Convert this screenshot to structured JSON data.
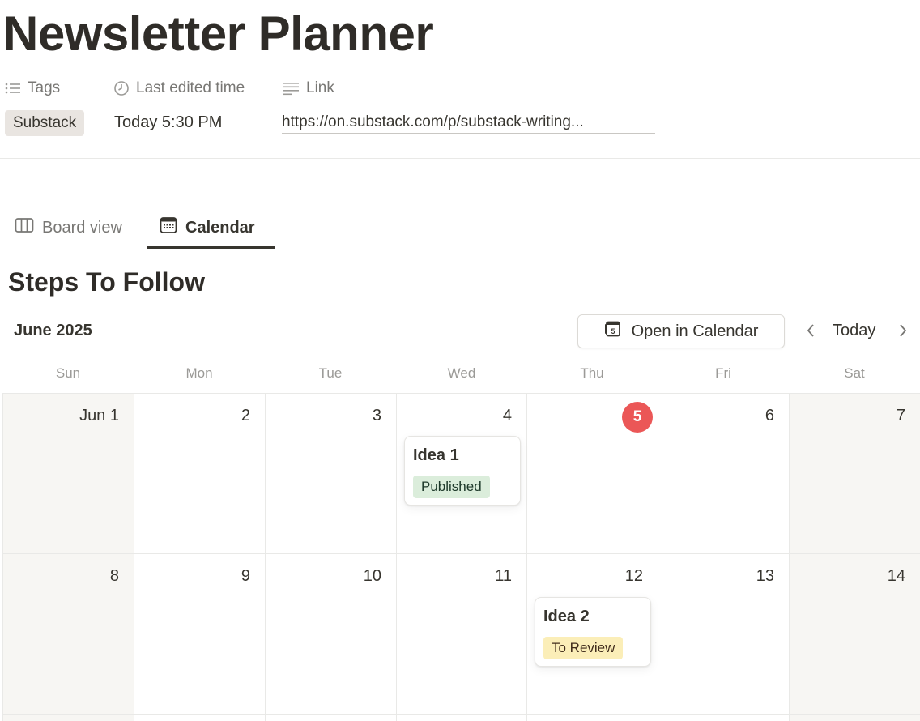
{
  "page": {
    "title": "Newsletter Planner"
  },
  "properties": {
    "tags_label": "Tags",
    "edited_label": "Last edited time",
    "link_label": "Link",
    "tag_value": "Substack",
    "edited_value": "Today 5:30 PM",
    "link_value": "https://on.substack.com/p/substack-writing..."
  },
  "tabs": [
    {
      "label": "Board view",
      "icon": "board-icon",
      "active": false
    },
    {
      "label": "Calendar",
      "icon": "calendar-icon",
      "active": true
    }
  ],
  "section": {
    "title": "Steps To Follow"
  },
  "calendar": {
    "month": "June 2025",
    "open_button": "Open in Calendar",
    "today_button": "Today",
    "weekdays": [
      "Sun",
      "Mon",
      "Tue",
      "Wed",
      "Thu",
      "Fri",
      "Sat"
    ],
    "days": [
      "Jun 1",
      "2",
      "3",
      "4",
      "5",
      "6",
      "7",
      "8",
      "9",
      "10",
      "11",
      "12",
      "13",
      "14"
    ],
    "today_day": "5",
    "events": [
      {
        "title": "Idea 1",
        "status": "Published",
        "day": "4",
        "status_color": "#dbeddb"
      },
      {
        "title": "Idea 2",
        "status": "To Review",
        "day": "12",
        "status_color": "#fbeeb8"
      }
    ]
  },
  "colors": {
    "today_badge": "#eb5757",
    "weekend_bg": "#f7f6f3"
  }
}
